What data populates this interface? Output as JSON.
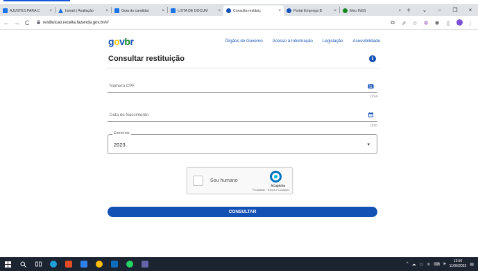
{
  "browser": {
    "tabs": [
      {
        "title": "AJUSTES PARA C",
        "color": "#1a73e8"
      },
      {
        "title": "Ismart | Avaliação",
        "color": "#1a73e8"
      },
      {
        "title": "Guia do candidat",
        "color": "#1a73e8"
      },
      {
        "title": "LISTA DE DOCUM",
        "color": "#1a73e8"
      },
      {
        "title": "Consulta restituiç",
        "color": "#1351b4",
        "active": true
      },
      {
        "title": "Portal Emprega B",
        "color": "#1351b4"
      },
      {
        "title": "Meu INSS",
        "color": "#168821"
      }
    ],
    "close_glyph": "×",
    "new_tab_glyph": "+",
    "window_controls": {
      "dropdown": "⌄",
      "minimize": "–",
      "maximize": "❐",
      "close": "×"
    },
    "nav": {
      "back": "←",
      "forward": "→",
      "reload": "C"
    },
    "url": "restituicao.receita.fazenda.gov.br/#/",
    "lock": "🔒"
  },
  "header": {
    "logo": {
      "g": "g",
      "o": "o",
      "v": "v",
      "b": "b",
      "r": "r"
    },
    "nav": [
      "Órgãos do Governo",
      "Acesso à Informação",
      "Legislação",
      "Acessibilidade"
    ]
  },
  "form": {
    "title": "Consultar restituição",
    "info_glyph": "i",
    "cpf": {
      "label": "Número CPF",
      "counter": "0/14",
      "icon": "keyboard-icon"
    },
    "birth": {
      "label": "Data de Nascimento",
      "counter": "0/10",
      "icon": "calendar-icon"
    },
    "exercise": {
      "legend": "Exercício",
      "value": "2023",
      "caret": "▾"
    },
    "captcha": {
      "label": "Sou humano",
      "brand": "hCaptcha",
      "links": "Privacidade - Termos e Condições"
    },
    "submit_label": "CONSULTAR"
  },
  "taskbar": {
    "clock_time": "13:50",
    "clock_date": "11/06/2023"
  }
}
